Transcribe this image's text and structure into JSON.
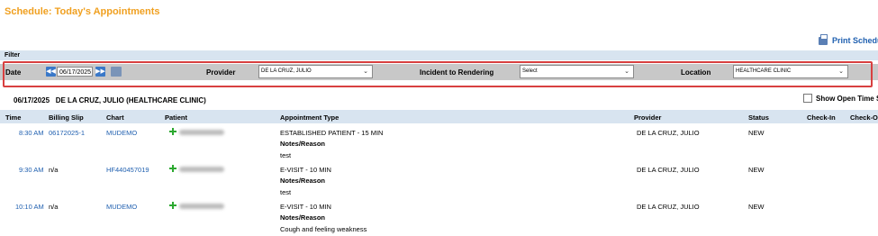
{
  "page_title": "Schedule: Today's Appointments",
  "print_label": "Print Schedule",
  "filter": {
    "header": "Filter",
    "date_label": "Date",
    "date_value": "06/17/2025",
    "provider_label": "Provider",
    "provider_value": "DE LA CRUZ, JULIO",
    "incident_label": "Incident to Rendering",
    "incident_value": "Select",
    "location_label": "Location",
    "location_value": "HEALTHCARE CLINIC"
  },
  "schedule_info": {
    "date": "06/17/2025",
    "provider_location": "DE LA CRUZ, JULIO (HEALTHCARE CLINIC)",
    "open_slots_label": "Show Open Time Slots"
  },
  "columns": [
    "Time",
    "Billing Slip",
    "Chart",
    "Patient",
    "Appointment Type",
    "Provider",
    "Status",
    "Check-In",
    "Check-Out"
  ],
  "appointments": [
    {
      "time": "8:30 AM",
      "billing_slip": "06172025-1",
      "chart": "MUDEMO",
      "appointment_type": "ESTABLISHED PATIENT - 15 MIN",
      "notes_label": "Notes/Reason",
      "notes": "test",
      "provider": "DE LA CRUZ, JULIO",
      "status": "NEW"
    },
    {
      "time": "9:30 AM",
      "billing_slip": "n/a",
      "chart": "HF440457019",
      "appointment_type": "E-VISIT - 10 MIN",
      "notes_label": "Notes/Reason",
      "notes": "test",
      "provider": "DE LA CRUZ, JULIO",
      "status": "NEW"
    },
    {
      "time": "10:10 AM",
      "billing_slip": "n/a",
      "chart": "MUDEMO",
      "appointment_type": "E-VISIT - 10 MIN",
      "notes_label": "Notes/Reason",
      "notes": "Cough and feeling weakness",
      "provider": "DE LA CRUZ, JULIO",
      "status": "NEW"
    }
  ],
  "colors": {
    "title": "#f0a020",
    "link": "#2060b0",
    "header_bg": "#d8e4f0",
    "filter_bg": "#c8c8c8",
    "highlight_outline": "#d84040",
    "plus_icon": "#2ca830"
  }
}
